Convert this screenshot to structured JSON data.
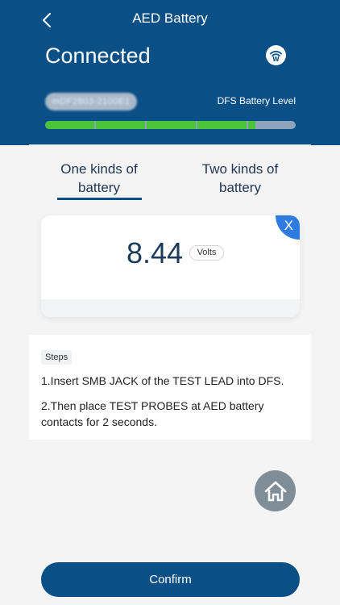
{
  "header": {
    "title": "AED Battery",
    "status": "Connected",
    "device_id": "mDF2803-2100E1",
    "level_label": "DFS Battery Level",
    "battery_level_percent": 84
  },
  "icons": {
    "back": "chevron-left",
    "wifi": "wifi-w-logo",
    "home": "home",
    "close": "x"
  },
  "tabs": [
    {
      "label": "One kinds of battery",
      "line1": "One kinds of",
      "line2": "battery",
      "active": true
    },
    {
      "label": "Two kinds of battery",
      "line1": "Two kinds of",
      "line2": "battery",
      "active": false
    }
  ],
  "reading": {
    "value": "8.44",
    "unit": "Volts",
    "close_label": "X"
  },
  "steps": {
    "tag": "Steps",
    "items": [
      "1.Insert SMB JACK of the TEST LEAD into DFS.",
      "2.Then place TEST PROBES at AED battery contacts for 2 seconds."
    ]
  },
  "actions": {
    "confirm_label": "Confirm"
  },
  "colors": {
    "primary": "#0a4f86",
    "battery_fill": "#4cc43a",
    "battery_track": "#8ea4bd",
    "accent_blue": "#2f7ce0"
  }
}
